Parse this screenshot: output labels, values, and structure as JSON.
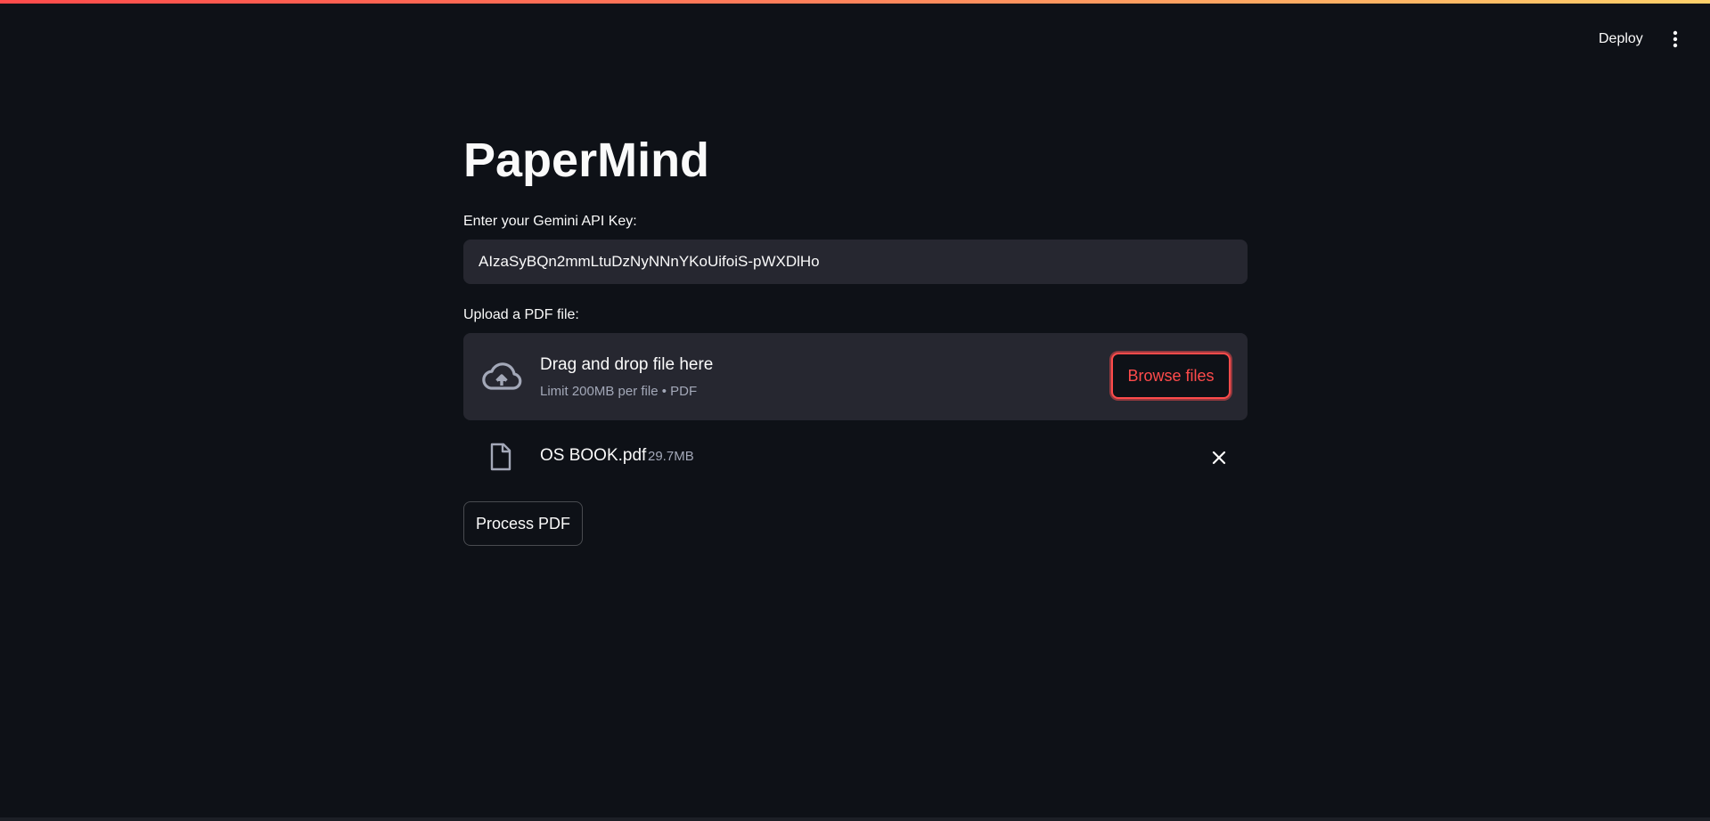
{
  "colors": {
    "background": "#0e1117",
    "surface": "#262730",
    "accent": "#ff4b4b",
    "text": "#fafafa",
    "muted_text": "#a3a8b8"
  },
  "header": {
    "deploy_label": "Deploy",
    "menu_icon": "vertical-ellipsis-icon"
  },
  "main": {
    "title": "PaperMind",
    "api_key": {
      "label": "Enter your Gemini API Key:",
      "value": "AIzaSyBQn2mmLtuDzNyNNnYKoUifoiS-pWXDlHo"
    },
    "uploader": {
      "label": "Upload a PDF file:",
      "dropzone_title": "Drag and drop file here",
      "dropzone_subtitle": "Limit 200MB per file • PDF",
      "browse_label": "Browse files",
      "upload_icon": "cloud-upload-icon"
    },
    "uploaded_file": {
      "name": "OS BOOK.pdf",
      "size": "29.7MB",
      "file_icon": "file-icon",
      "remove_icon": "close-icon"
    },
    "process_button_label": "Process PDF"
  }
}
